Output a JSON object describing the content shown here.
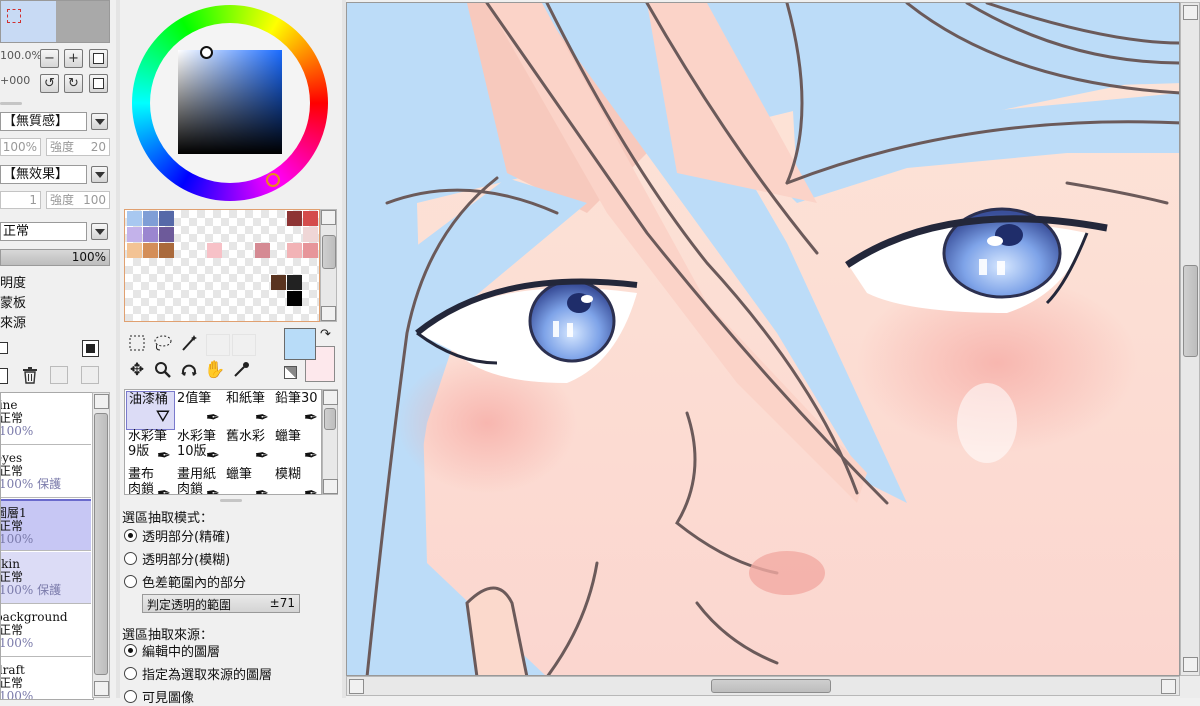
{
  "navigator": {
    "zoom": "100.0%",
    "rotation": "+000"
  },
  "brush_texture": {
    "value": "【無質感】",
    "intensity_pct": "100%",
    "intensity_label": "強度",
    "intensity_value": "20"
  },
  "brush_effect": {
    "value": "【無效果】",
    "width_value": "1",
    "intensity_label": "強度",
    "intensity_value": "100"
  },
  "blend_mode": {
    "value": "正常",
    "opacity": "100%"
  },
  "layer_options": [
    "明度",
    "蒙板",
    "來源"
  ],
  "layers": [
    {
      "name": "line",
      "mode": "正常",
      "opacity": "100%",
      "extra": "",
      "selected": false
    },
    {
      "name": "eyes",
      "mode": "正常",
      "opacity": "100%",
      "extra": "保護",
      "selected": false
    },
    {
      "name": "圖層1",
      "mode": "正常",
      "opacity": "100%",
      "extra": "",
      "selected": true
    },
    {
      "name": "skin",
      "mode": "正常",
      "opacity": "100%",
      "extra": "保護",
      "selected": false
    },
    {
      "name": "background",
      "mode": "正常",
      "opacity": "100%",
      "extra": "",
      "selected": false
    },
    {
      "name": "draft",
      "mode": "正常",
      "opacity": "100%",
      "extra": "",
      "selected": false
    }
  ],
  "colors": {
    "primary": "#b8dcf8",
    "secondary": "#fde8ec",
    "hue_marker": "#e98c1a"
  },
  "swatches": [
    {
      "row": 0,
      "col": 0,
      "color": "#a8c8f0"
    },
    {
      "row": 0,
      "col": 1,
      "color": "#7f9ed6"
    },
    {
      "row": 0,
      "col": 2,
      "color": "#5669a8"
    },
    {
      "row": 1,
      "col": 0,
      "color": "#c3b2ea"
    },
    {
      "row": 1,
      "col": 1,
      "color": "#9b86d0"
    },
    {
      "row": 1,
      "col": 2,
      "color": "#6d5a9a"
    },
    {
      "row": 2,
      "col": 0,
      "color": "#f3c394"
    },
    {
      "row": 2,
      "col": 1,
      "color": "#d48e58"
    },
    {
      "row": 2,
      "col": 2,
      "color": "#aa6a3c"
    },
    {
      "row": 2,
      "col": 5,
      "color": "#f7c1c7"
    },
    {
      "row": 2,
      "col": 8,
      "color": "#d58a93"
    },
    {
      "row": 2,
      "col": 10,
      "color": "#f2b3b6"
    },
    {
      "row": 2,
      "col": 11,
      "color": "#e7959a"
    },
    {
      "row": 0,
      "col": 10,
      "color": "#8d3434"
    },
    {
      "row": 0,
      "col": 11,
      "color": "#d44c4c"
    },
    {
      "row": 1,
      "col": 11,
      "color": "#efd6d6"
    },
    {
      "row": 4,
      "col": 9,
      "color": "#5a3420"
    },
    {
      "row": 4,
      "col": 10,
      "color": "#222222"
    },
    {
      "row": 5,
      "col": 10,
      "color": "#000000"
    }
  ],
  "tool_icons": [
    "select-rect-icon",
    "lasso-icon",
    "magic-wand-icon",
    "move-icon",
    "zoom-icon",
    "rotate-icon",
    "hand-icon",
    "eyedropper-icon"
  ],
  "brushes": [
    {
      "name": "油漆桶",
      "icon": "bucket",
      "selected": true
    },
    {
      "name": "2值筆",
      "icon": "pen",
      "selected": false
    },
    {
      "name": "和紙筆",
      "icon": "pen",
      "selected": false
    },
    {
      "name": "鉛筆30",
      "icon": "pen",
      "selected": false
    },
    {
      "name": "水彩筆\n9版",
      "icon": "pen",
      "selected": false
    },
    {
      "name": "水彩筆\n10版",
      "icon": "pen",
      "selected": false
    },
    {
      "name": "舊水彩",
      "icon": "pen",
      "selected": false
    },
    {
      "name": "蠟筆",
      "icon": "pen",
      "selected": false
    },
    {
      "name": "畫布\n肉鎖",
      "icon": "pen",
      "selected": false
    },
    {
      "name": "畫用紙\n肉鎖",
      "icon": "pen",
      "selected": false
    },
    {
      "name": "蠟筆",
      "icon": "pen",
      "selected": false
    },
    {
      "name": "模糊",
      "icon": "pen",
      "selected": false
    }
  ],
  "fill_options": {
    "mode_title": "選區抽取模式：",
    "modes": [
      {
        "label": "透明部分(精確)",
        "checked": true
      },
      {
        "label": "透明部分(模糊)",
        "checked": false
      },
      {
        "label": "色差範圍內的部分",
        "checked": false
      }
    ],
    "range_label": "判定透明的範圍",
    "range_value": "±71",
    "source_title": "選區抽取來源：",
    "sources": [
      {
        "label": "編輯中的圖層",
        "checked": true
      },
      {
        "label": "指定為選取來源的圖層",
        "checked": false
      },
      {
        "label": "可見圖像",
        "checked": false
      }
    ]
  }
}
